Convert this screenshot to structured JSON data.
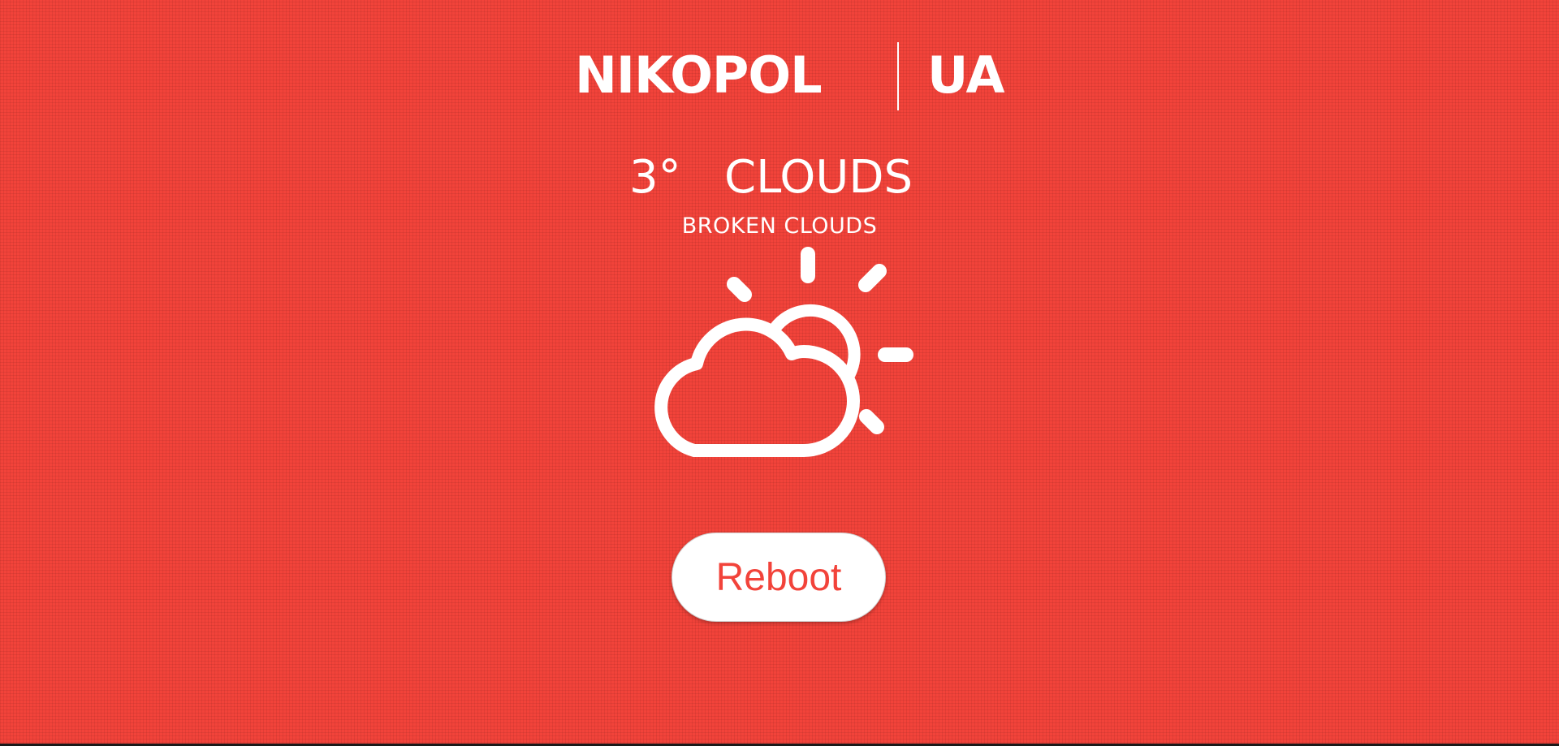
{
  "location": {
    "city": "NIKOPOL",
    "country": "UA"
  },
  "weather": {
    "temperature": "3°",
    "condition": "CLOUDS",
    "description": "BROKEN CLOUDS",
    "icon": "partly-cloudy-icon"
  },
  "actions": {
    "reboot_label": "Reboot"
  },
  "colors": {
    "background": "#f2433a",
    "foreground": "#ffffff",
    "button_text": "#f2433a"
  }
}
